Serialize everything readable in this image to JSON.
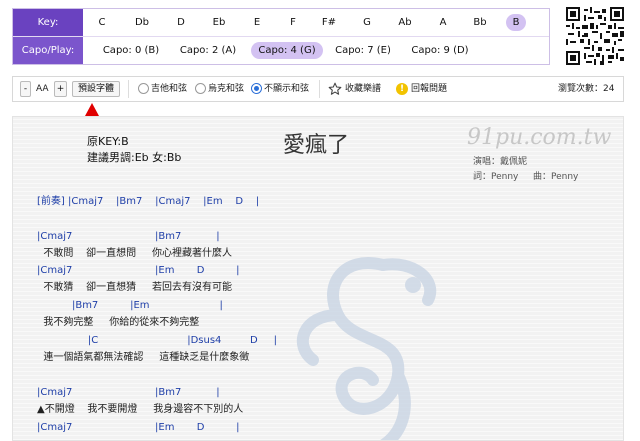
{
  "key_selector": {
    "key_label": "Key:",
    "capo_label": "Capo/Play:",
    "keys": [
      "C",
      "Db",
      "D",
      "Eb",
      "E",
      "F",
      "F#",
      "G",
      "Ab",
      "A",
      "Bb",
      "B"
    ],
    "selected_key": "B",
    "capos": [
      "Capo: 0 (B)",
      "Capo: 2 (A)",
      "Capo: 4 (G)",
      "Capo: 7 (E)",
      "Capo: 9 (D)"
    ],
    "selected_capo": "Capo: 4 (G)"
  },
  "toolbar": {
    "font_minus": "-",
    "font_size": "AA",
    "font_plus": "+",
    "default_font": "預設字體",
    "radio_options": [
      "吉他和弦",
      "烏克和弦",
      "不顯示和弦"
    ],
    "radio_selected": "不顯示和弦",
    "favorite": "收藏樂譜",
    "report": "回報問題",
    "view_count": "瀏覽次數：24"
  },
  "sheet": {
    "original_key": "原KEY:B",
    "suggested_key": "建議男調:Eb 女:Bb",
    "title": "愛瘋了",
    "site": "91pu.com.tw",
    "singer": "演唱：戴佩妮",
    "lyricist": "詞：Penny",
    "composer": "曲：Penny",
    "lines": [
      "[前奏] |Cmaj7    |Bm7    |Cmaj7    |Em    D    |",
      "|Cmaj7                          |Bm7           |",
      "  不敢問    卻一直想問     你心裡藏著什麼人",
      "|Cmaj7                          |Em       D          |",
      "  不敢猜    卻一直想猜     若回去有沒有可能",
      "           |Bm7          |Em                      |",
      "  我不夠完整     你給的從來不夠完整",
      "                |C                            |Dsus4         D     |",
      "  連一個語氣都無法確認     這種缺乏是什麼象徵",
      "|Cmaj7                          |Bm7           |",
      "▲不開燈    我不要開燈     我身邊容不下別的人",
      "|Cmaj7                          |Em       D          |"
    ]
  },
  "colors": {
    "accent_purple": "#6a42c0",
    "selected_pill": "#d3c2f2",
    "chord_blue": "#1f3fa8",
    "arrow_red": "#e00000"
  }
}
